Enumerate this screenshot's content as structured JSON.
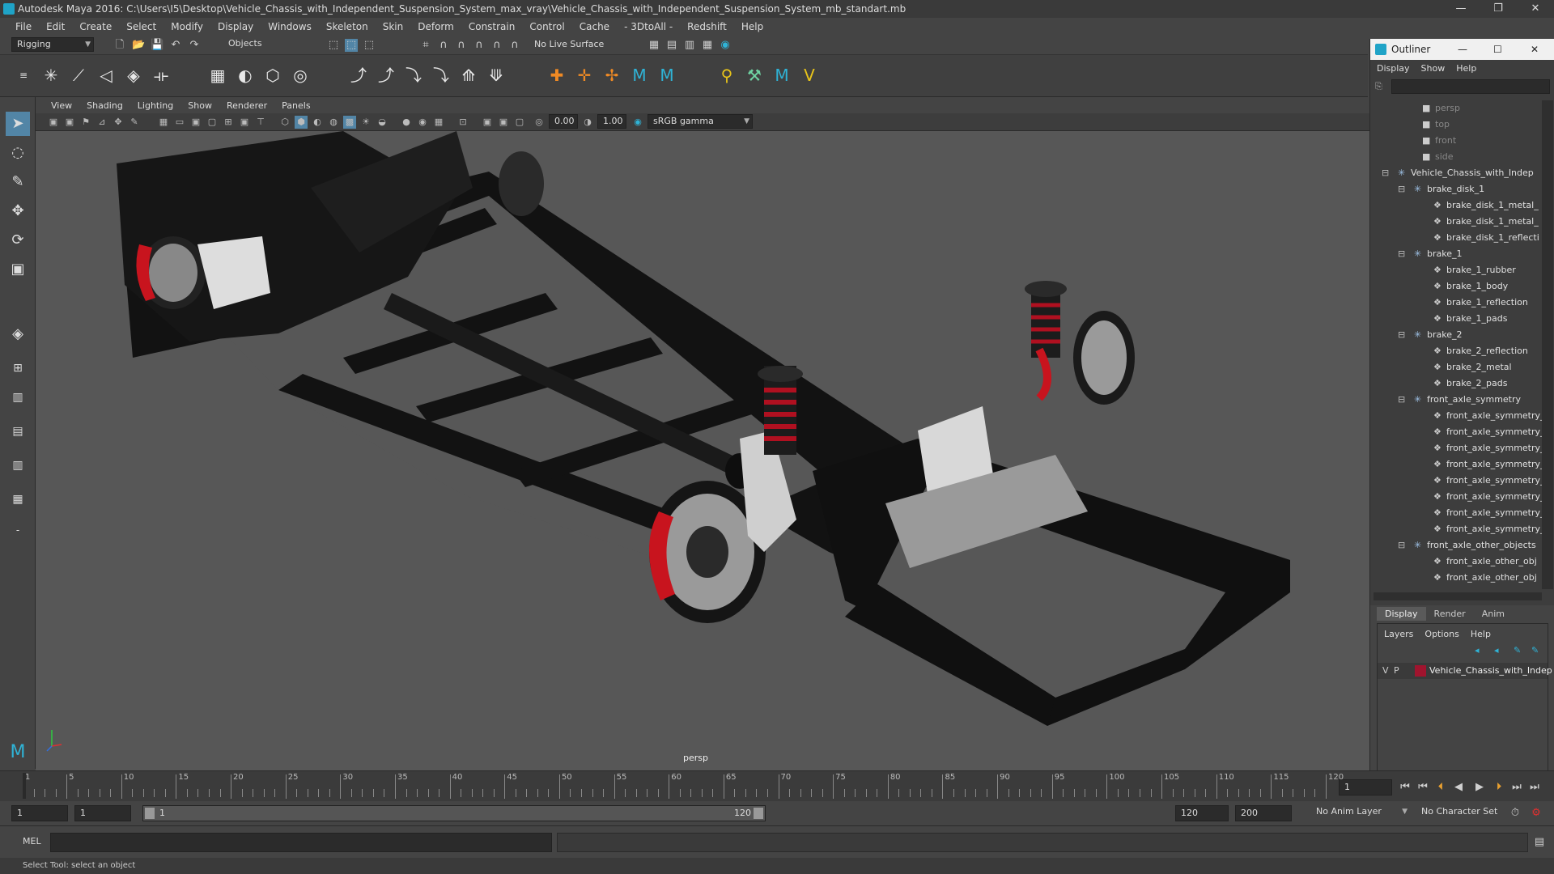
{
  "title": "Autodesk Maya 2016: C:\\Users\\I5\\Desktop\\Vehicle_Chassis_with_Independent_Suspension_System_max_vray\\Vehicle_Chassis_with_Independent_Suspension_System_mb_standart.mb",
  "window_controls": {
    "minimize": "—",
    "restore": "❐",
    "close": "✕"
  },
  "menu": [
    "File",
    "Edit",
    "Create",
    "Select",
    "Modify",
    "Display",
    "Windows",
    "Skeleton",
    "Skin",
    "Deform",
    "Constrain",
    "Control",
    "Cache",
    "- 3DtoAll -",
    "Redshift",
    "Help"
  ],
  "menuset": "Rigging",
  "objects_dropdown": "Objects",
  "live_surface": "No Live Surface",
  "viewport_menu": [
    "View",
    "Shading",
    "Lighting",
    "Show",
    "Renderer",
    "Panels"
  ],
  "viewport_fields": {
    "near": "0.00",
    "far": "1.00",
    "colorspace": "sRGB gamma"
  },
  "viewport_label": "persp",
  "outliner": {
    "title": "Outliner",
    "menu": [
      "Display",
      "Show",
      "Help"
    ],
    "items": [
      {
        "label": "persp",
        "indent": 0,
        "kind": "camera"
      },
      {
        "label": "top",
        "indent": 0,
        "kind": "camera"
      },
      {
        "label": "front",
        "indent": 0,
        "kind": "camera"
      },
      {
        "label": "side",
        "indent": 0,
        "kind": "camera"
      },
      {
        "label": "Vehicle_Chassis_with_Indep",
        "indent": 0,
        "kind": "group"
      },
      {
        "label": "brake_disk_1",
        "indent": 1,
        "kind": "group"
      },
      {
        "label": "brake_disk_1_metal_",
        "indent": 2,
        "kind": "mesh"
      },
      {
        "label": "brake_disk_1_metal_",
        "indent": 2,
        "kind": "mesh"
      },
      {
        "label": "brake_disk_1_reflecti",
        "indent": 2,
        "kind": "mesh"
      },
      {
        "label": "brake_1",
        "indent": 1,
        "kind": "group"
      },
      {
        "label": "brake_1_rubber",
        "indent": 2,
        "kind": "mesh"
      },
      {
        "label": "brake_1_body",
        "indent": 2,
        "kind": "mesh"
      },
      {
        "label": "brake_1_reflection",
        "indent": 2,
        "kind": "mesh"
      },
      {
        "label": "brake_1_pads",
        "indent": 2,
        "kind": "mesh"
      },
      {
        "label": "brake_2",
        "indent": 1,
        "kind": "group"
      },
      {
        "label": "brake_2_reflection",
        "indent": 2,
        "kind": "mesh"
      },
      {
        "label": "brake_2_metal",
        "indent": 2,
        "kind": "mesh"
      },
      {
        "label": "brake_2_pads",
        "indent": 2,
        "kind": "mesh"
      },
      {
        "label": "front_axle_symmetry",
        "indent": 1,
        "kind": "group"
      },
      {
        "label": "front_axle_symmetry_",
        "indent": 2,
        "kind": "mesh"
      },
      {
        "label": "front_axle_symmetry_",
        "indent": 2,
        "kind": "mesh"
      },
      {
        "label": "front_axle_symmetry_",
        "indent": 2,
        "kind": "mesh"
      },
      {
        "label": "front_axle_symmetry_",
        "indent": 2,
        "kind": "mesh"
      },
      {
        "label": "front_axle_symmetry_",
        "indent": 2,
        "kind": "mesh"
      },
      {
        "label": "front_axle_symmetry_",
        "indent": 2,
        "kind": "mesh"
      },
      {
        "label": "front_axle_symmetry_",
        "indent": 2,
        "kind": "mesh"
      },
      {
        "label": "front_axle_symmetry_",
        "indent": 2,
        "kind": "mesh"
      },
      {
        "label": "front_axle_other_objects",
        "indent": 1,
        "kind": "group"
      },
      {
        "label": "front_axle_other_obj",
        "indent": 2,
        "kind": "mesh"
      },
      {
        "label": "front_axle_other_obj",
        "indent": 2,
        "kind": "mesh"
      }
    ]
  },
  "layer_editor": {
    "tabs": [
      "Display",
      "Render",
      "Anim"
    ],
    "active_tab": "Display",
    "menu": [
      "Layers",
      "Options",
      "Help"
    ],
    "layer": {
      "visible": "V",
      "playback": "P",
      "name": "Vehicle_Chassis_with_Indep",
      "color": "#a0142e"
    }
  },
  "timeline": {
    "ticks": [
      "5",
      "10",
      "15",
      "20",
      "25",
      "30",
      "35",
      "40",
      "45",
      "50",
      "55",
      "60",
      "65",
      "70",
      "75",
      "80",
      "85",
      "90",
      "95",
      "100",
      "105",
      "110",
      "115",
      "120"
    ],
    "first_tick": "1",
    "current_frame": "1"
  },
  "range": {
    "start": "1",
    "playback_start": "1",
    "slider_start": "1",
    "slider_end": "120",
    "playback_end": "120",
    "end": "200",
    "anim_layer": "No Anim Layer",
    "character_set": "No Character Set"
  },
  "cmd": {
    "mode": "MEL"
  },
  "help_line": "Select Tool: select an object",
  "colors": {
    "brake_red": "#c8141e",
    "chassis": "#141414",
    "viewport_bg": "#575757"
  }
}
